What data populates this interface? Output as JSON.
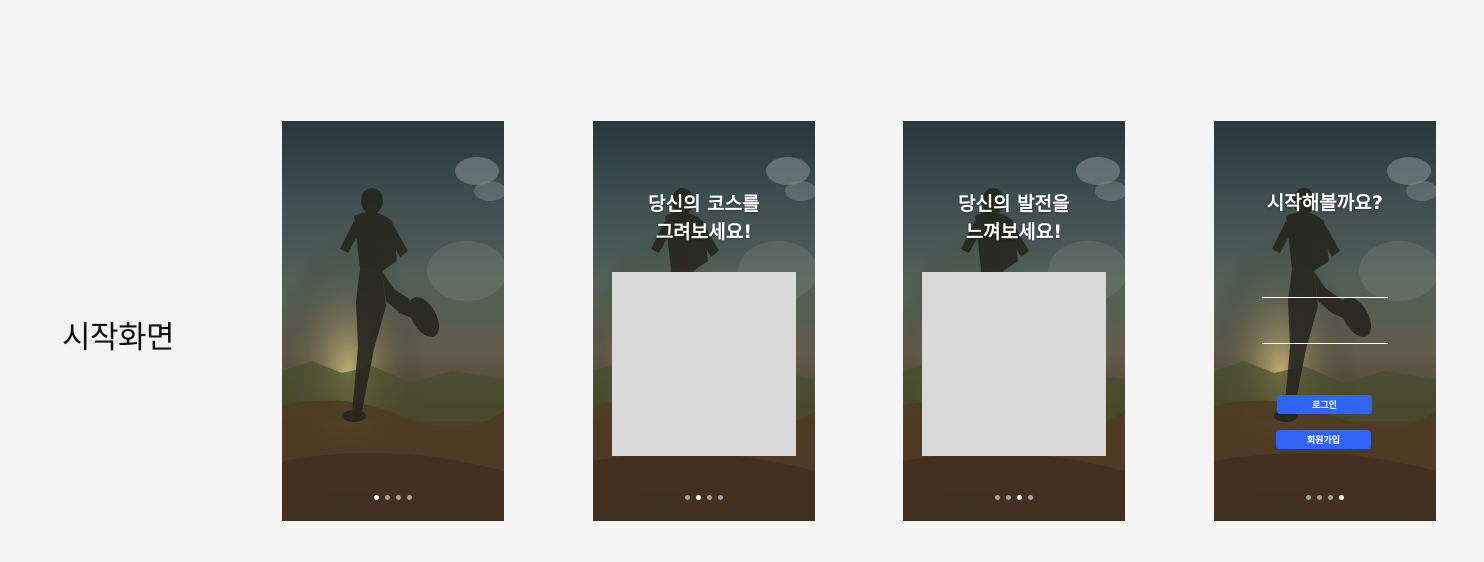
{
  "section_title": "시작화면",
  "colors": {
    "page_background": "#f4f4f4",
    "primary_button": "#2f64f5",
    "image_placeholder": "#d9d9d9",
    "text_on_photo": "#ffffff"
  },
  "screens": [
    {
      "headline_lines": [],
      "has_image_placeholder": false,
      "pager": {
        "total": 4,
        "active_index": 0
      }
    },
    {
      "headline_lines": [
        "당신의 코스를",
        "그려보세요!"
      ],
      "has_image_placeholder": true,
      "pager": {
        "total": 4,
        "active_index": 1
      }
    },
    {
      "headline_lines": [
        "당신의 발전을",
        "느껴보세요!"
      ],
      "has_image_placeholder": true,
      "pager": {
        "total": 4,
        "active_index": 2
      }
    },
    {
      "headline_lines": [
        "시작해볼까요?"
      ],
      "login_form": {
        "id_field_value": "",
        "password_field_value": "",
        "login_button_label": "로그인",
        "signup_button_label": "회원가입"
      },
      "pager": {
        "total": 4,
        "active_index": 3
      }
    }
  ]
}
